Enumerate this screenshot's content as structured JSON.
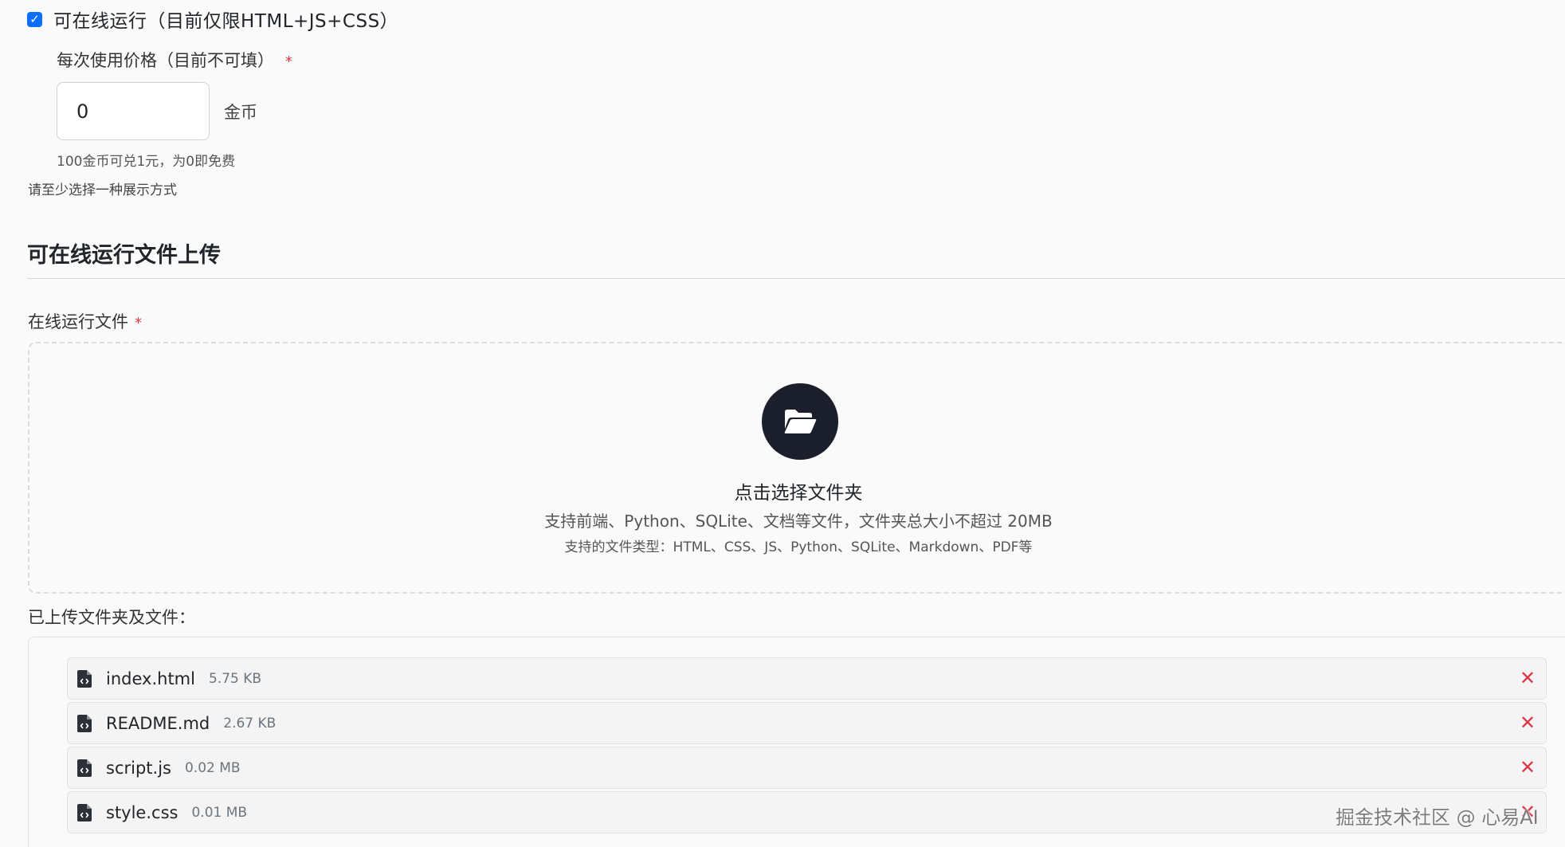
{
  "run_online": {
    "checked": true,
    "label": "可在线运行（目前仅限HTML+JS+CSS）"
  },
  "price": {
    "label": "每次使用价格（目前不可填）",
    "required_mark": "*",
    "value": "0",
    "unit": "金币",
    "hint": "100金币可兑1元，为0即免费"
  },
  "display_hint": "请至少选择一种展示方式",
  "section_title": "可在线运行文件上传",
  "files_field": {
    "label": "在线运行文件",
    "required_mark": "*"
  },
  "dropzone": {
    "icon": "folder-open-icon",
    "title": "点击选择文件夹",
    "subtitle": "支持前端、Python、SQLite、文档等文件，文件夹总大小不超过 20MB",
    "types": "支持的文件类型：HTML、CSS、JS、Python、SQLite、Markdown、PDF等"
  },
  "uploaded": {
    "label": "已上传文件夹及文件：",
    "files": [
      {
        "name": "index.html",
        "size": "5.75 KB",
        "remove": "✕"
      },
      {
        "name": "README.md",
        "size": "2.67 KB",
        "remove": "✕"
      },
      {
        "name": "script.js",
        "size": "0.02 MB",
        "remove": "✕"
      },
      {
        "name": "style.css",
        "size": "0.01 MB",
        "remove": "✕"
      }
    ]
  },
  "watermark": "掘金技术社区 @ 心易AI",
  "colors": {
    "accent": "#0d6efd",
    "danger": "#dc3545",
    "folder_circle": "#1a1f2b"
  }
}
